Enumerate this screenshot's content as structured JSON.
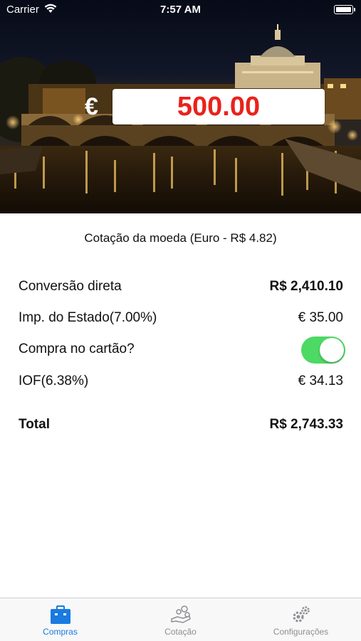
{
  "status_bar": {
    "carrier": "Carrier",
    "time": "7:57 AM"
  },
  "hero": {
    "image": "Rome St. Peter's Basilica and Ponte Sant'Angelo at night",
    "currency_symbol": "€",
    "amount_value": "500.00",
    "amount_color": "#e8231a"
  },
  "rate_label": "Cotação da moeda (Euro - R$ 4.82)",
  "rows": {
    "direct": {
      "label": "Conversão direta",
      "value": "R$ 2,410.10"
    },
    "state_tax": {
      "label": "Imp. do Estado(7.00%)",
      "value": "€ 35.00"
    },
    "card": {
      "label": "Compra no cartão?",
      "toggle_on": true,
      "toggle_color": "#4cd964"
    },
    "iof": {
      "label": "IOF(6.38%)",
      "value": "€ 34.13"
    },
    "total": {
      "label": "Total",
      "value": "R$ 2,743.33"
    }
  },
  "tabbar": {
    "accent": "#1a7ae0",
    "inactive": "#8e8e93",
    "tabs": [
      {
        "label": "Compras",
        "icon": "briefcase-icon",
        "active": true
      },
      {
        "label": "Cotação",
        "icon": "money-hand-icon",
        "active": false
      },
      {
        "label": "Configurações",
        "icon": "gears-icon",
        "active": false
      }
    ]
  }
}
